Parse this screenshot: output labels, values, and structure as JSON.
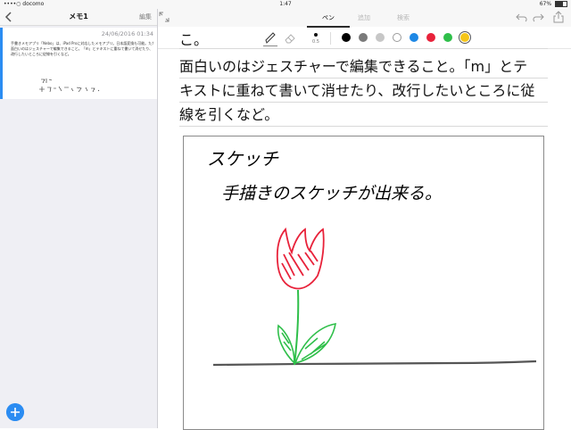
{
  "status_bar": {
    "carrier": "••••○ docomo",
    "time": "1:47",
    "battery": "67%",
    "battery_level": 0.67
  },
  "sidebar": {
    "title": "メモ1",
    "edit_label": "編集",
    "note": {
      "date": "24/06/2016 01:34",
      "preview_lines": [
        "手書きメモアプリ「Nebo」は、iPad Proに対応したメモアプリ。日本語変換も可能。ただ、少し説識力が劣いかも。",
        "面白いのはジェスチャーで編集できること。「m」とテキストに重ねて書いて消せたり、",
        "改行したいところに従線を引くなど。"
      ]
    },
    "add_icon": "plus-icon"
  },
  "toolbar": {
    "tabs": [
      {
        "label": "ペン",
        "active": true
      },
      {
        "label": "追加",
        "active": false
      },
      {
        "label": "検索",
        "active": false
      }
    ],
    "pen_size": "0.5",
    "colors": [
      "#000000",
      "#7a7a7a",
      "#c7c7c7",
      "#ffffff",
      "#1e88e5",
      "#e8223a",
      "#2fbf4a",
      "#f5c518"
    ],
    "selected_color": "#f5c518",
    "icons": [
      "back-icon",
      "expand-icon",
      "undo-icon",
      "redo-icon",
      "share-icon",
      "pen-icon",
      "eraser-icon"
    ]
  },
  "content": {
    "partial_top": "こ。",
    "lines": [
      "面白いのはジェスチャーで編集できること。「m」とテ",
      "キストに重ねて書いて消せたり、改行したいところに従",
      "線を引くなど。"
    ]
  },
  "sketch": {
    "heading": "スケッチ",
    "handwriting": "手描きのスケッチが出来る。",
    "colors": {
      "flower": "#e8223a",
      "stem": "#2fbf4a",
      "ground": "#555555"
    }
  }
}
